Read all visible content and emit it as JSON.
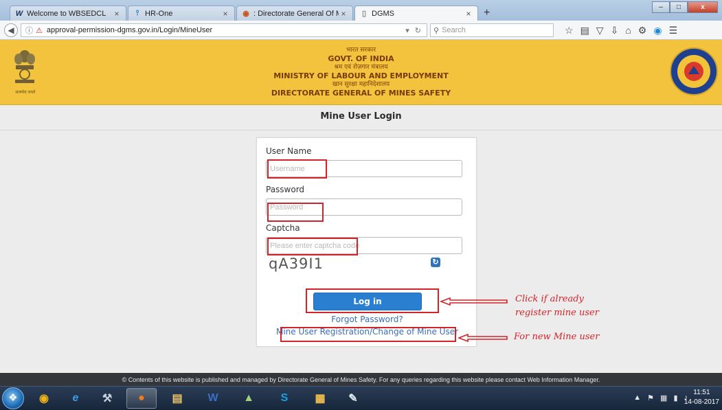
{
  "browser": {
    "tabs": [
      {
        "label": "Welcome to WBSEDCL",
        "icon": "W"
      },
      {
        "label": "HR-One",
        "icon": "⫯"
      },
      {
        "label": ": Directorate General Of Mine",
        "icon": "◉"
      },
      {
        "label": "DGMS",
        "icon": "▯"
      }
    ],
    "tab_close": "×",
    "new_tab": "+",
    "url": "approval-permission-dgms.gov.in/Login/MineUser",
    "search_placeholder": "Search",
    "window_buttons": [
      "–",
      "□",
      "x"
    ]
  },
  "header": {
    "emblem_caption": "सत्यमेव जयते",
    "line1_hi": "भारत सरकार",
    "line2_en": "GOVT. OF INDIA",
    "line3_hi": "श्रम एवं रोज़गार मंत्रालय",
    "line4_en": "MINISTRY OF LABOUR AND EMPLOYMENT",
    "line5_hi": "खान सुरक्षा महानिदेशालय",
    "line6_en": "DIRECTORATE GENERAL OF MINES SAFETY"
  },
  "login": {
    "title": "Mine User Login",
    "username_label": "User Name",
    "username_placeholder": "Username",
    "password_label": "Password",
    "password_placeholder": "Password",
    "captcha_label": "Captcha",
    "captcha_placeholder": "Please enter captcha code",
    "captcha_text": "qA39I1",
    "login_button": "Log in",
    "forgot_link": "Forgot Password?",
    "register_link": "Mine User Registration/Change of Mine User"
  },
  "annotations": {
    "login_note_line1": "Click if already",
    "login_note_line2": "register mine user",
    "register_note": "For new Mine user"
  },
  "footer": {
    "text": "© Contents of this website is published and managed by Directorate General of Mines Safety. For any queries regarding this website please contact Web Information Manager."
  },
  "taskbar": {
    "time": "11:51",
    "date": "14-08-2017"
  },
  "colors": {
    "header_bg": "#f3c33e",
    "login_button": "#2b7fd0",
    "annotation_red": "#d3222a",
    "link": "#3a6db5"
  }
}
